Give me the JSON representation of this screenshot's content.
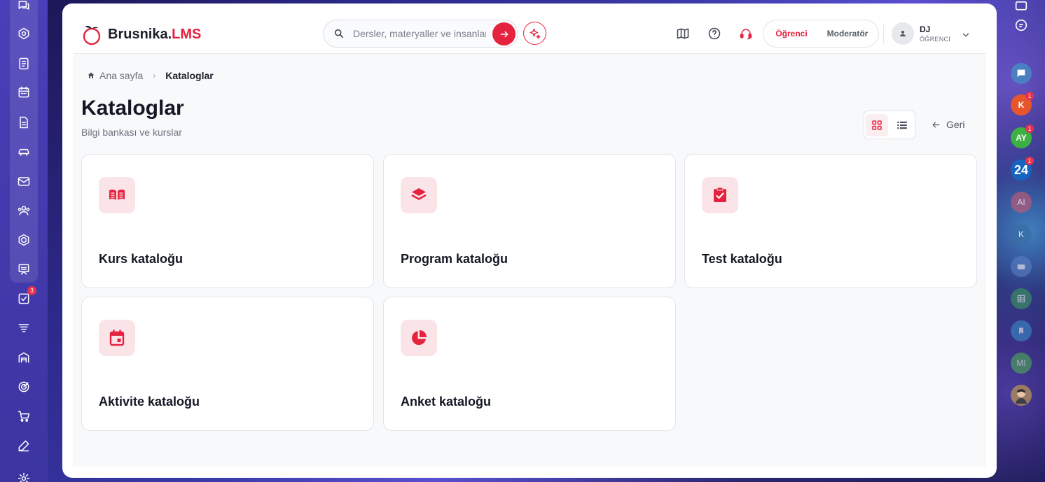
{
  "app": {
    "brand_main": "Brusnika.",
    "brand_accent": "LMS",
    "accent_color": "#e5233f"
  },
  "search": {
    "placeholder": "Dersler, materyaller ve insanlar"
  },
  "roles": {
    "active": "Öğrenci",
    "inactive": "Moderatör"
  },
  "user": {
    "initials": "DJ",
    "role": "ÖĞRENCI"
  },
  "breadcrumb": {
    "home": "Ana sayfa",
    "current": "Kataloglar"
  },
  "page": {
    "title": "Kataloglar",
    "subtitle": "Bilgi bankası ve kurslar",
    "back_label": "Geri"
  },
  "catalogs": [
    {
      "label": "Kurs kataloğu",
      "icon": "book-open-icon"
    },
    {
      "label": "Program kataloğu",
      "icon": "layers-icon"
    },
    {
      "label": "Test kataloğu",
      "icon": "clipboard-check-icon"
    },
    {
      "label": "Aktivite kataloğu",
      "icon": "calendar-icon"
    },
    {
      "label": "Anket kataloğu",
      "icon": "pie-chart-icon"
    }
  ],
  "left_sidebar": {
    "task_badge": "3"
  },
  "right_rail": {
    "contacts": [
      {
        "initials": "K",
        "badge": "1",
        "color": "#e8552a"
      },
      {
        "initials": "AY",
        "badge": "1",
        "color": "#3cb043"
      },
      {
        "initials": "24",
        "badge": "1",
        "color": "#1565c0"
      },
      {
        "initials": "AI",
        "badge": "",
        "color": "#b05a7a"
      },
      {
        "initials": "K",
        "badge": "",
        "color": "#3a6ea5"
      },
      {
        "initials": "MI",
        "badge": "",
        "color": "#4caf50"
      }
    ]
  }
}
